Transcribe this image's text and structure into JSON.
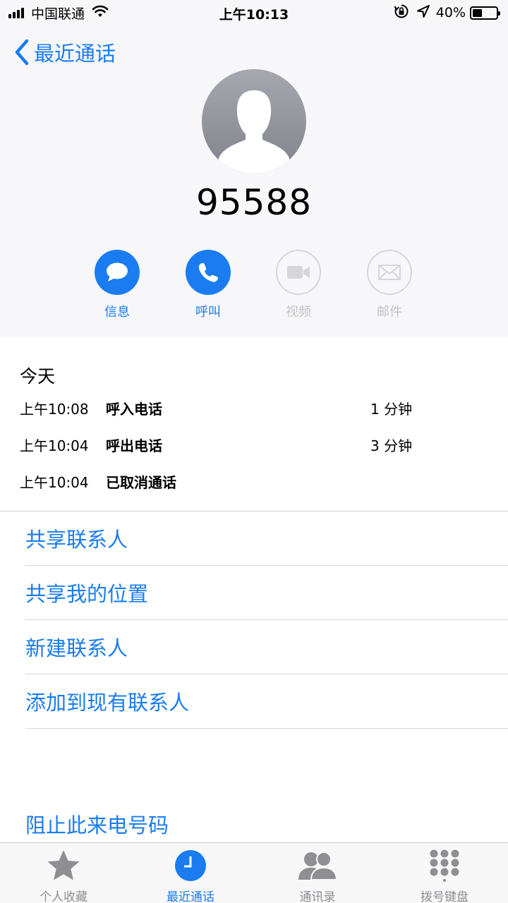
{
  "status_bar": {
    "carrier": "中国联通",
    "time": "上午10:13",
    "battery": "40%",
    "battery_level": 0.4
  },
  "nav": {
    "back_label": "最近通话"
  },
  "contact": {
    "number": "95588"
  },
  "actions": [
    {
      "label": "信息",
      "icon": "message-icon",
      "enabled": true
    },
    {
      "label": "呼叫",
      "icon": "phone-icon",
      "enabled": true
    },
    {
      "label": "视频",
      "icon": "video-icon",
      "enabled": false
    },
    {
      "label": "邮件",
      "icon": "mail-icon",
      "enabled": false
    }
  ],
  "history": {
    "heading": "今天",
    "calls": [
      {
        "time": "上午10:08",
        "type": "呼入电话",
        "duration": "1 分钟"
      },
      {
        "time": "上午10:04",
        "type": "呼出电话",
        "duration": "3 分钟"
      },
      {
        "time": "上午10:04",
        "type": "已取消通话",
        "duration": ""
      }
    ]
  },
  "options": [
    "共享联系人",
    "共享我的位置",
    "新建联系人",
    "添加到现有联系人"
  ],
  "block_option": "阻止此来电号码",
  "tabs": [
    {
      "label": "个人收藏",
      "icon": "star-icon",
      "selected": false
    },
    {
      "label": "最近通话",
      "icon": "clock-icon",
      "selected": true
    },
    {
      "label": "通讯录",
      "icon": "contacts-icon",
      "selected": false
    },
    {
      "label": "拨号键盘",
      "icon": "keypad-icon",
      "selected": false
    }
  ],
  "colors": {
    "accent": "#1a7cf0",
    "disabled": "#c2c2c6",
    "header_bg": "#f7f7fa",
    "tab_inactive": "#8e8e93"
  }
}
